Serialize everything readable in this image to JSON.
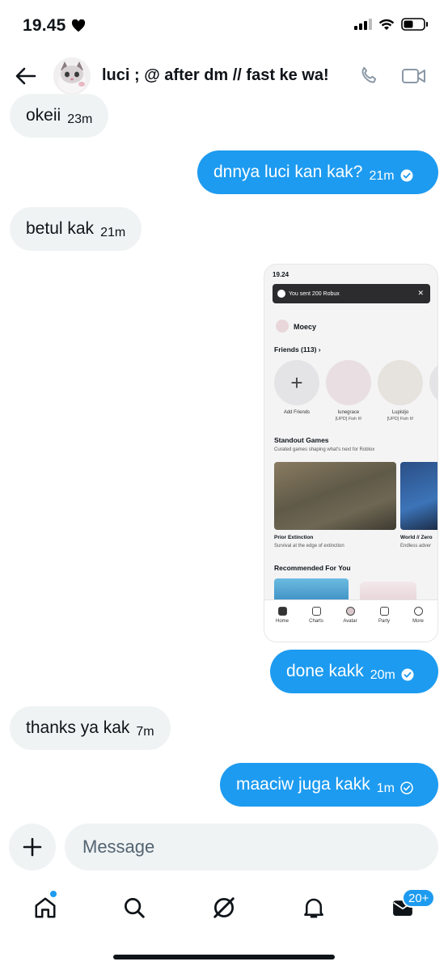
{
  "status_bar": {
    "time": "19.45"
  },
  "header": {
    "title": "luci ; @ after dm // fast ke wa!"
  },
  "messages": [
    {
      "text": "okeii",
      "time": "23m"
    },
    {
      "text": "dnnya luci kan kak?",
      "time": "21m"
    },
    {
      "text": "betul kak",
      "time": "21m"
    },
    {
      "text": "done kakk",
      "time": "20m"
    },
    {
      "text": "thanks ya kak",
      "time": "7m"
    },
    {
      "text": "maaciw juga kakk",
      "time": "1m"
    }
  ],
  "attachment": {
    "status_time": "19.24",
    "toast": "You sent 200 Robux",
    "username": "Moecy",
    "friends_label": "Friends (113)",
    "friends": [
      {
        "name": "Add Friends",
        "sub": ""
      },
      {
        "name": "lunegrace",
        "sub": "[UPD] Fish It!"
      },
      {
        "name": "Lupisljo",
        "sub": "[UPD] Fish It!"
      }
    ],
    "standout_title": "Standout Games",
    "standout_sub": "Curated games shaping what's next for Roblox",
    "games": [
      {
        "name": "Prior Extinction",
        "desc": "Survival at the edge of extinction"
      },
      {
        "name": "World // Zero",
        "desc": "Endless adver"
      }
    ],
    "recommended_title": "Recommended For You",
    "nav": [
      "Home",
      "Charts",
      "Avatar",
      "Party",
      "More"
    ]
  },
  "composer": {
    "placeholder": "Message"
  },
  "bottom_nav": {
    "badge": "20+"
  },
  "colors": {
    "accent": "#1d9bf0",
    "incoming_bubble": "#eff3f4",
    "text": "#0f1419"
  }
}
